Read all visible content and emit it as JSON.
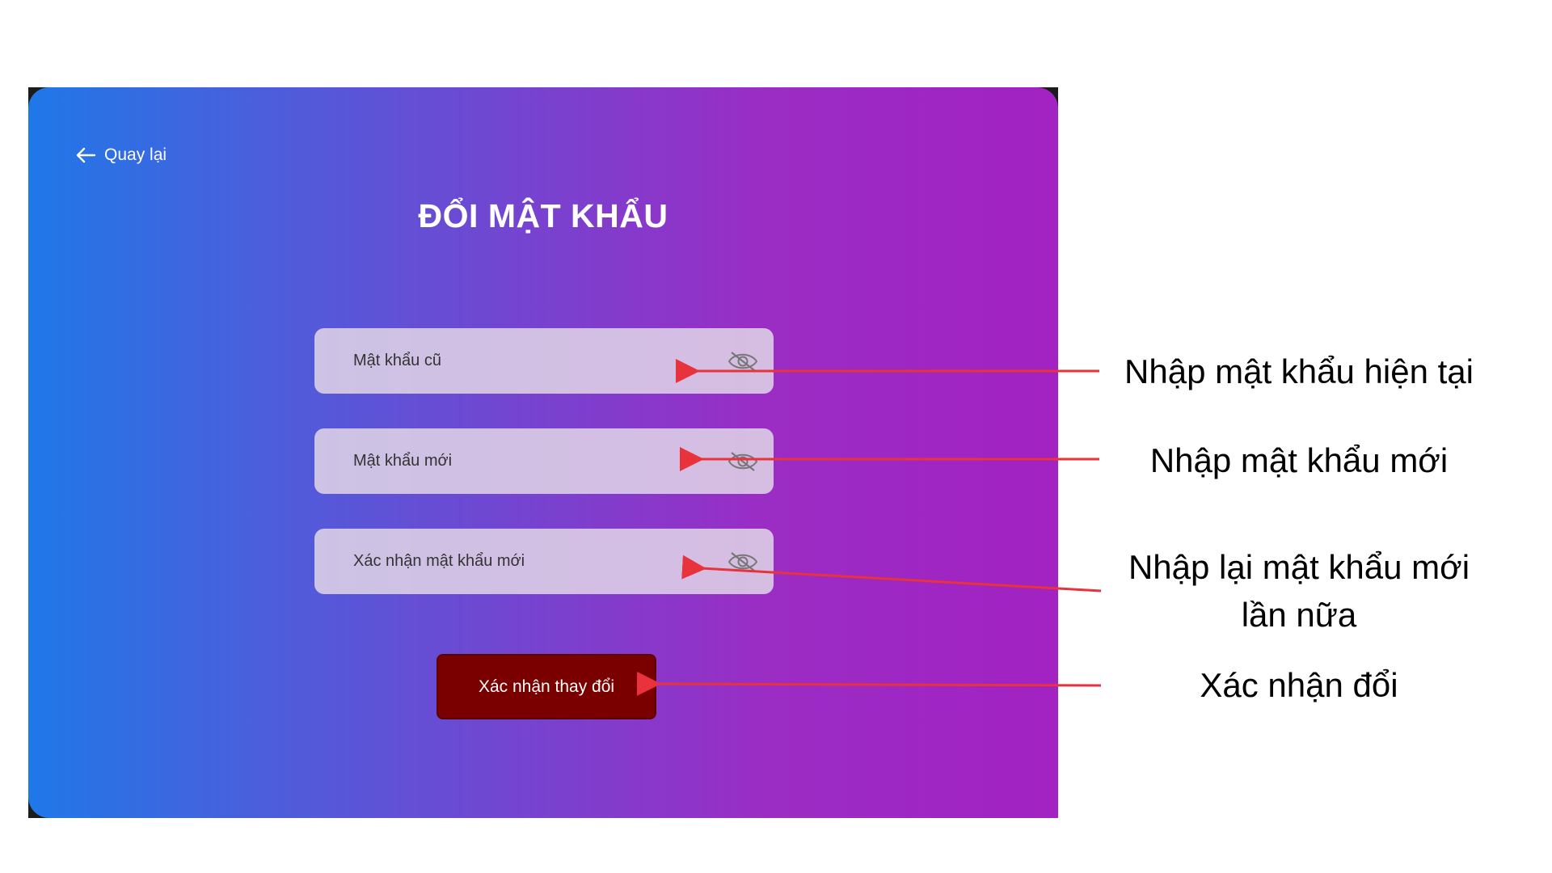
{
  "app": {
    "back_label": "Quay lại",
    "title": "ĐỔI MẬT KHẨU",
    "fields": [
      {
        "label": "Mật khẩu cũ",
        "icon": "eye-off-icon"
      },
      {
        "label": "Mật khẩu mới",
        "icon": "eye-off-icon"
      },
      {
        "label": "Xác nhận mật khẩu mới",
        "icon": "eye-off-icon"
      }
    ],
    "submit_label": "Xác nhận thay đổi"
  },
  "annotations": [
    "Nhập mật khẩu hiện tại",
    "Nhập mật khẩu mới",
    "Nhập lại mật khẩu mới\nlần nữa",
    "Xác nhận đổi"
  ],
  "colors": {
    "gradient_start": "#1f78e8",
    "gradient_end": "#a222c2",
    "submit_button": "#7a0000",
    "arrow": "#e8323c"
  }
}
